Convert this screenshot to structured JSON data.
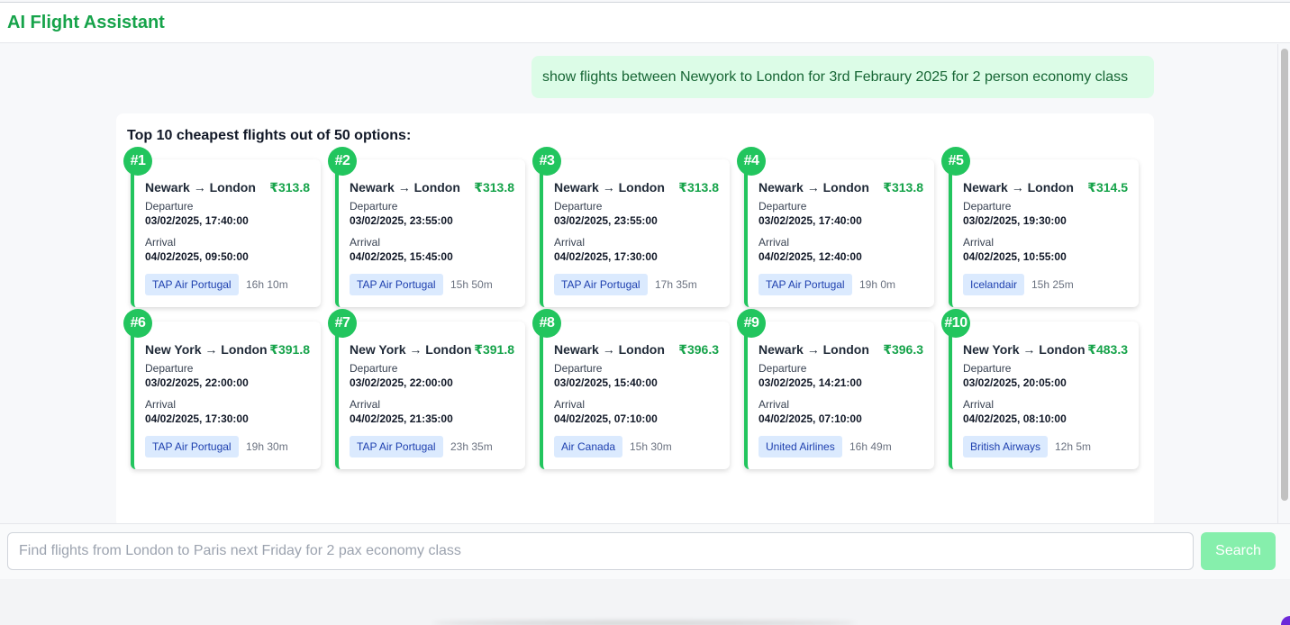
{
  "app": {
    "title": "AI Flight Assistant"
  },
  "chat": {
    "user_message": "show flights between Newyork to London for 3rd Febraury 2025 for 2 person economy class",
    "assistant_heading": "Top 10 cheapest flights out of 50 options:"
  },
  "labels": {
    "departure": "Departure",
    "arrival": "Arrival"
  },
  "flights": [
    {
      "rank": "#1",
      "route": "Newark → London",
      "price": "₹313.8",
      "departure": "03/02/2025, 17:40:00",
      "arrival": "04/02/2025, 09:50:00",
      "airline": "TAP Air Portugal",
      "duration": "16h 10m"
    },
    {
      "rank": "#2",
      "route": "Newark → London",
      "price": "₹313.8",
      "departure": "03/02/2025, 23:55:00",
      "arrival": "04/02/2025, 15:45:00",
      "airline": "TAP Air Portugal",
      "duration": "15h 50m"
    },
    {
      "rank": "#3",
      "route": "Newark → London",
      "price": "₹313.8",
      "departure": "03/02/2025, 23:55:00",
      "arrival": "04/02/2025, 17:30:00",
      "airline": "TAP Air Portugal",
      "duration": "17h 35m"
    },
    {
      "rank": "#4",
      "route": "Newark → London",
      "price": "₹313.8",
      "departure": "03/02/2025, 17:40:00",
      "arrival": "04/02/2025, 12:40:00",
      "airline": "TAP Air Portugal",
      "duration": "19h 0m"
    },
    {
      "rank": "#5",
      "route": "Newark → London",
      "price": "₹314.5",
      "departure": "03/02/2025, 19:30:00",
      "arrival": "04/02/2025, 10:55:00",
      "airline": "Icelandair",
      "duration": "15h 25m"
    },
    {
      "rank": "#6",
      "route": "New York → London",
      "price": "₹391.8",
      "departure": "03/02/2025, 22:00:00",
      "arrival": "04/02/2025, 17:30:00",
      "airline": "TAP Air Portugal",
      "duration": "19h 30m"
    },
    {
      "rank": "#7",
      "route": "New York → London",
      "price": "₹391.8",
      "departure": "03/02/2025, 22:00:00",
      "arrival": "04/02/2025, 21:35:00",
      "airline": "TAP Air Portugal",
      "duration": "23h 35m"
    },
    {
      "rank": "#8",
      "route": "Newark → London",
      "price": "₹396.3",
      "departure": "03/02/2025, 15:40:00",
      "arrival": "04/02/2025, 07:10:00",
      "airline": "Air Canada",
      "duration": "15h 30m"
    },
    {
      "rank": "#9",
      "route": "Newark → London",
      "price": "₹396.3",
      "departure": "03/02/2025, 14:21:00",
      "arrival": "04/02/2025, 07:10:00",
      "airline": "United Airlines",
      "duration": "16h 49m"
    },
    {
      "rank": "#10",
      "route": "New York → London",
      "price": "₹483.3",
      "departure": "03/02/2025, 20:05:00",
      "arrival": "04/02/2025, 08:10:00",
      "airline": "British Airways",
      "duration": "12h 5m"
    }
  ],
  "input": {
    "placeholder": "Find flights from London to Paris next Friday for 2 pax economy class",
    "value": "",
    "search_label": "Search"
  },
  "colors": {
    "brand": "#16a34a",
    "accent": "#22c55e",
    "user_bubble": "#dcfce7",
    "airline_tag": "#dbeafe",
    "search_button": "#86efac"
  }
}
